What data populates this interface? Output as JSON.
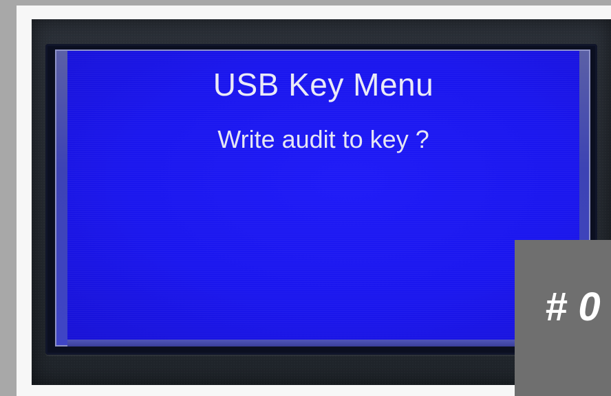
{
  "screen": {
    "title": "USB Key Menu",
    "prompt": "Write audit to key ?",
    "background_color": "#1e1af7",
    "text_color": "#eaeaf7"
  },
  "overlay": {
    "label": "# 0"
  }
}
